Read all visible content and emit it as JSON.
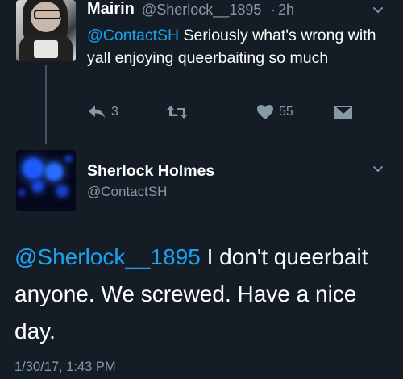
{
  "reply_tweet": {
    "author_name": "Mairin",
    "author_handle": "@Sherlock__1895",
    "separator": "·",
    "age": "2h",
    "mention": "@ContactSH",
    "text": " Seriously what's wrong with yall enjoying queerbaiting so much",
    "actions": {
      "reply": {
        "icon": "reply-icon",
        "count": "3"
      },
      "retweet": {
        "icon": "retweet-icon",
        "count": ""
      },
      "like": {
        "icon": "heart-icon",
        "count": "55"
      },
      "direct_message": {
        "icon": "envelope-icon"
      }
    },
    "avatar_icon": "profile-photo-icon"
  },
  "main_tweet": {
    "author_name": "Sherlock Holmes",
    "author_handle": "@ContactSH",
    "mention": "@Sherlock__1895",
    "text": " I don't queerbait anyone. We screwed. Have a nice day.",
    "timestamp": "1/30/17, 1:43 PM",
    "avatar_icon": "blue-lights-avatar-icon"
  },
  "colors": {
    "background": "#141d26",
    "text": "#ffffff",
    "secondary_text": "#8899a6",
    "link": "#1da1f2"
  }
}
